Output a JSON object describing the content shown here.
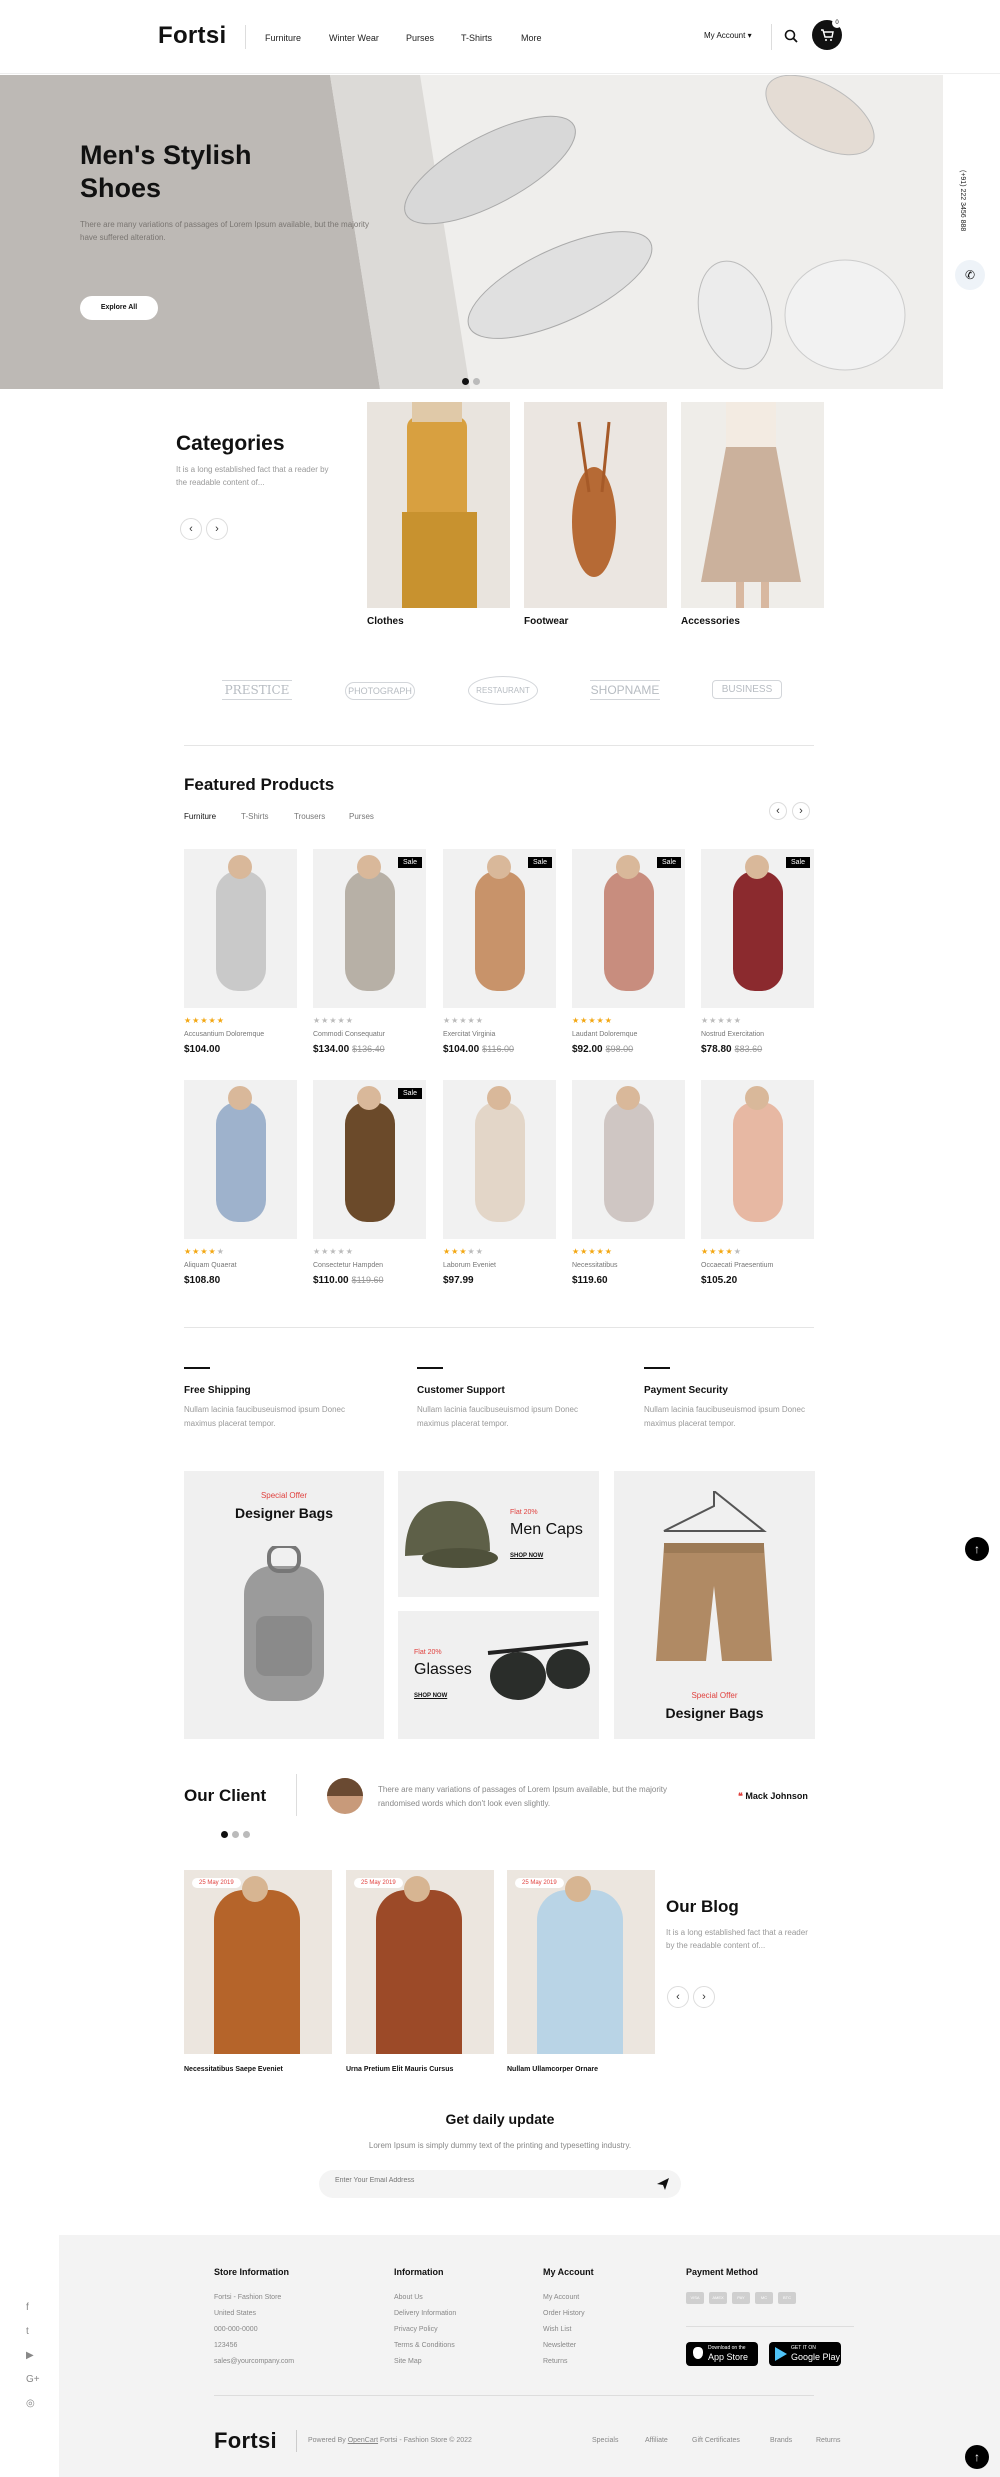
{
  "header": {
    "logo": "Fortsi",
    "nav": [
      "Furniture",
      "Winter Wear",
      "Purses",
      "T-Shirts",
      "More"
    ],
    "account": "My Account",
    "account_caret": "▾",
    "cart_count": "0"
  },
  "hero": {
    "title_line1": "Men's Stylish",
    "title_line2": "Shoes",
    "text": "There are many variations of passages of Lorem Ipsum available, but the majority have suffered alteration.",
    "button": "Explore All"
  },
  "side": {
    "phone": "(+91) 222 3456 888"
  },
  "categories": {
    "title": "Categories",
    "text": "It is a long established fact that a reader by the readable content of...",
    "items": [
      "Clothes",
      "Footwear",
      "Accessories"
    ]
  },
  "brands": [
    "PRESTICE",
    "PHOTOGRAPH",
    "RESTAURANT",
    "SHOPNAME",
    "BUSINESS"
  ],
  "featured": {
    "title": "Featured Products",
    "tabs": [
      "Furniture",
      "T-Shirts",
      "Trousers",
      "Purses"
    ],
    "sale_label": "Sale",
    "products": [
      {
        "name": "Accusantium Doloremque",
        "price": "$104.00",
        "old": "",
        "rating": 5,
        "sale": false,
        "color": "#c9c9c9"
      },
      {
        "name": "Commodi Consequatur",
        "price": "$134.00",
        "old": "$136.40",
        "rating": 0,
        "sale": true,
        "color": "#b7b0a6"
      },
      {
        "name": "Exercitat Virginia",
        "price": "$104.00",
        "old": "$116.00",
        "rating": 0,
        "sale": true,
        "color": "#c8936a"
      },
      {
        "name": "Laudant Doloremque",
        "price": "$92.00",
        "old": "$98.00",
        "rating": 5,
        "sale": true,
        "color": "#c88d7e"
      },
      {
        "name": "Nostrud Exercitation",
        "price": "$78.80",
        "old": "$83.60",
        "rating": 0,
        "sale": true,
        "color": "#8b2a2e"
      },
      {
        "name": "Aliquam Quaerat",
        "price": "$108.80",
        "old": "",
        "rating": 4,
        "sale": false,
        "color": "#9eb2cc"
      },
      {
        "name": "Consectetur Hampden",
        "price": "$110.00",
        "old": "$119.60",
        "rating": 0,
        "sale": true,
        "color": "#6b4a2a"
      },
      {
        "name": "Laborum Eveniet",
        "price": "$97.99",
        "old": "",
        "rating": 3,
        "sale": false,
        "color": "#e3d6c8"
      },
      {
        "name": "Necessitatibus",
        "price": "$119.60",
        "old": "",
        "rating": 5,
        "sale": false,
        "color": "#cfc6c3"
      },
      {
        "name": "Occaecati Praesentium",
        "price": "$105.20",
        "old": "",
        "rating": 4,
        "sale": false,
        "color": "#e7b8a3"
      }
    ]
  },
  "services": [
    {
      "title": "Free Shipping",
      "text": "Nullam lacinia faucibuseuismod ipsum Donec maximus placerat tempor."
    },
    {
      "title": "Customer Support",
      "text": "Nullam lacinia faucibuseuismod ipsum Donec maximus placerat tempor."
    },
    {
      "title": "Payment Security",
      "text": "Nullam lacinia faucibuseuismod ipsum Donec maximus placerat tempor."
    }
  ],
  "banners": {
    "bags_tag": "Special Offer",
    "bags_title": "Designer Bags",
    "caps_tag": "Flat 20%",
    "caps_title": "Men Caps",
    "caps_link": "SHOP NOW",
    "glasses_tag": "Flat 20%",
    "glasses_title": "Glasses",
    "glasses_link": "SHOP NOW",
    "shorts_tag": "Special Offer",
    "shorts_title": "Designer Bags"
  },
  "client": {
    "title": "Our Client",
    "quote": "There are many variations of passages of Lorem Ipsum available, but the majority randomised words which don't look even slightly.",
    "quote_icon": "❝",
    "name": "Mack Johnson"
  },
  "blog": {
    "title": "Our Blog",
    "text": "It is a long established fact that a reader by the readable content of...",
    "posts": [
      {
        "date": "25 May 2019",
        "title": "Necessitatibus Saepe Eveniet",
        "color": "#b5642a"
      },
      {
        "date": "25 May 2019",
        "title": "Urna Pretium Elit Mauris Cursus",
        "color": "#9c4a28"
      },
      {
        "date": "25 May 2019",
        "title": "Nullam Ullamcorper Ornare",
        "color": "#b9d4e6"
      }
    ]
  },
  "newsletter": {
    "title": "Get daily update",
    "text": "Lorem Ipsum is simply dummy text of the printing and typesetting industry.",
    "placeholder": "Enter Your Email Address"
  },
  "footer": {
    "store_title": "Store Information",
    "store": [
      "Fortsi - Fashion Store",
      "United States",
      "000-000-0000",
      "123456",
      "sales@yourcompany.com"
    ],
    "info_title": "Information",
    "info": [
      "About Us",
      "Delivery Information",
      "Privacy Policy",
      "Terms & Conditions",
      "Site Map"
    ],
    "account_title": "My Account",
    "account": [
      "My Account",
      "Order History",
      "Wish List",
      "Newsletter",
      "Returns"
    ],
    "payment_title": "Payment Method",
    "payment_cards": [
      "VISA",
      "AMEX",
      "PAY",
      "MC",
      "BTC"
    ],
    "app_store": {
      "small": "Download on the",
      "big": "App Store"
    },
    "google_play": {
      "small": "GET IT ON",
      "big": "Google Play"
    },
    "logo": "Fortsi",
    "copy_prefix": "Powered By ",
    "copy_link": "OpenCart",
    "copy_suffix": " Fortsi - Fashion Store © 2022",
    "links": [
      "Specials",
      "Affiliate",
      "Gift Certificates",
      "Brands",
      "Returns"
    ]
  },
  "social": [
    "f",
    "t",
    "▶",
    "G+",
    "◎"
  ]
}
